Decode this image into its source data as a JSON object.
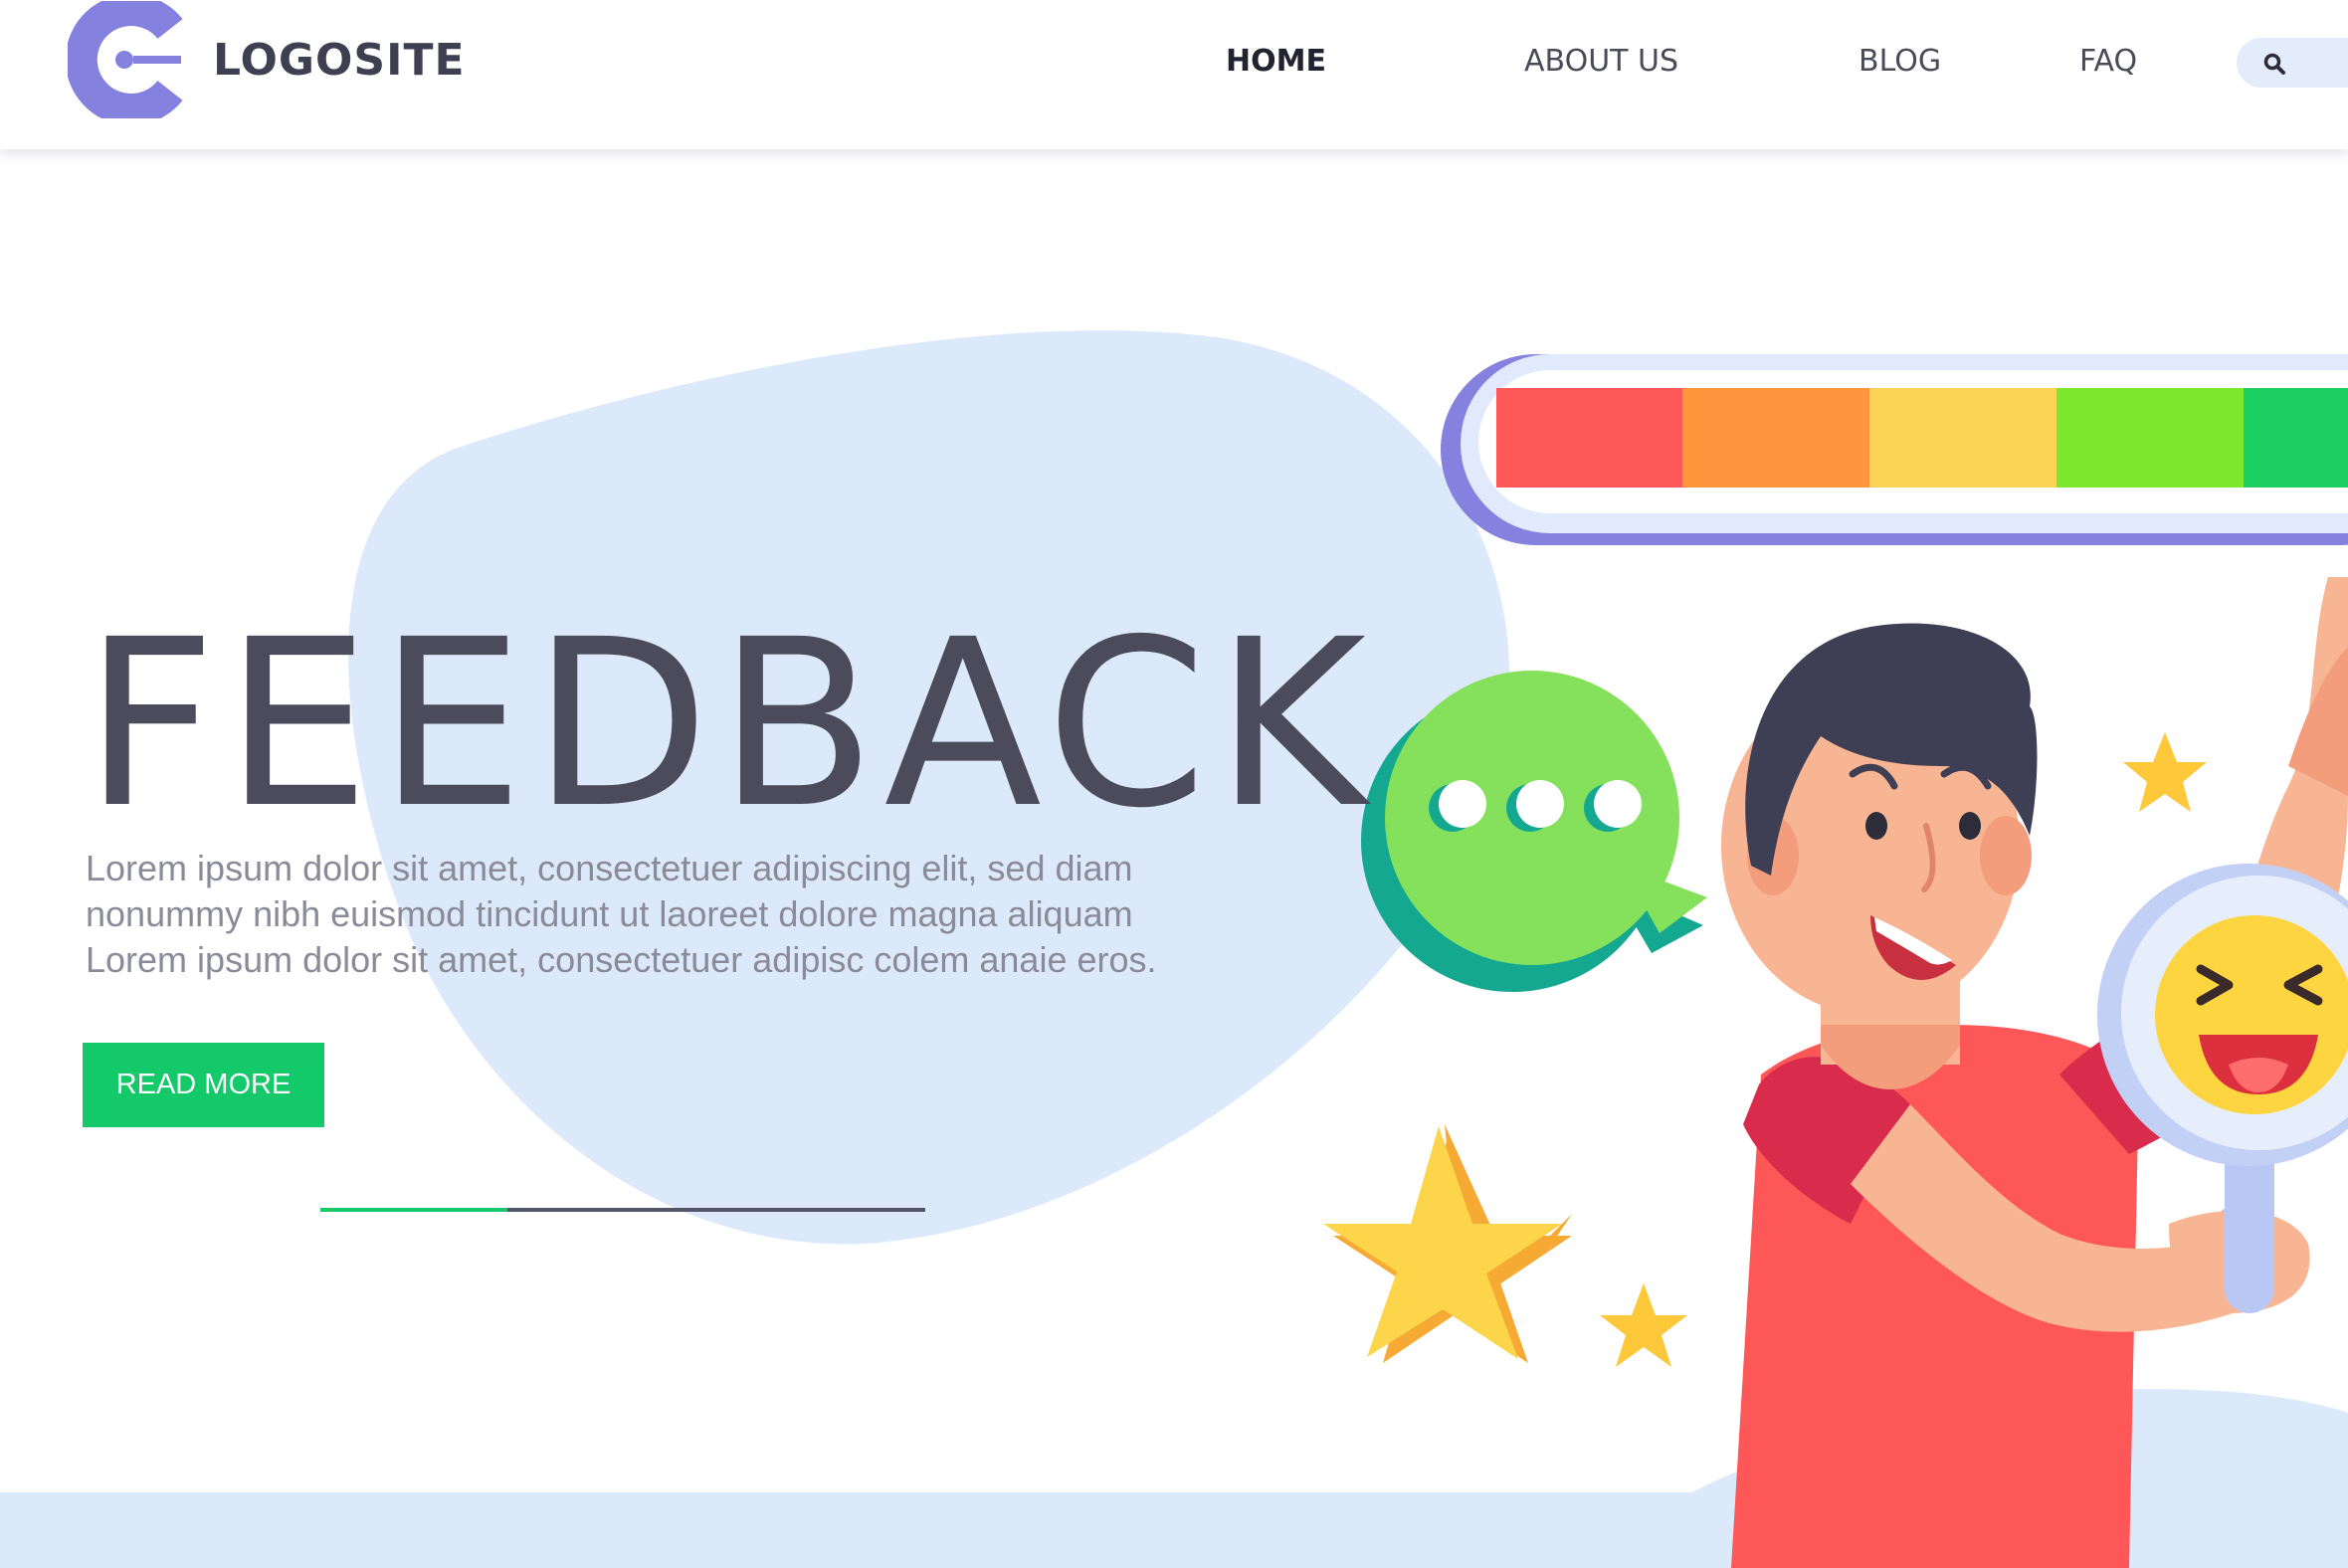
{
  "site": {
    "logo_text": "LOGOSITE"
  },
  "nav": {
    "items": [
      {
        "label": "HOME",
        "active": true
      },
      {
        "label": "ABOUT US",
        "active": false
      },
      {
        "label": "BLOG",
        "active": false
      },
      {
        "label": "FAQ",
        "active": false
      }
    ]
  },
  "search": {
    "icon": "search-icon"
  },
  "hero": {
    "title": "FEEDBACK",
    "description": "Lorem ipsum dolor sit amet, consectetuer adipiscing elit, sed diam nonummy nibh euismod tincidunt ut laoreet dolore magna aliquam Lorem ipsum dolor sit amet, consectetuer adipisc colem anaie eros.",
    "button_label": "READ MORE",
    "slider_progress": 0.31
  },
  "rating_meter": {
    "segment_colors": [
      "#fe5757",
      "#fd963c",
      "#fdd556",
      "#7be82b",
      "#1ccf62"
    ]
  },
  "colors": {
    "brand_purple": "#8481df",
    "accent_green": "#13c96a",
    "text_dark": "#4b4b5c",
    "blob_light_blue": "#dce9fb"
  }
}
